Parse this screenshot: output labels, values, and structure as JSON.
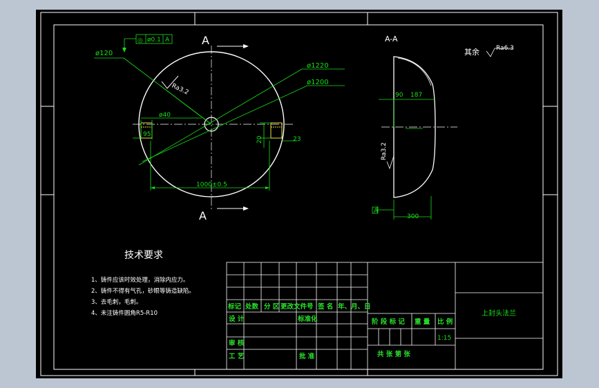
{
  "colors": {
    "background": "#000000",
    "window_frame": "#bcc6d2",
    "outline": "#ffffff",
    "dimension": "#19e019",
    "hatch_hole": "#f0e040",
    "title_text": "#29e029"
  },
  "drawing": {
    "front_view": {
      "section_marker_top": "A",
      "section_marker_bottom": "A",
      "dims": {
        "d120": "ø120",
        "d1220": "ø1220",
        "d1200": "ø1200",
        "d40": "ø40",
        "d95": "95",
        "d20": "20",
        "d23": "23",
        "d1000": "1000±0.5"
      },
      "roughness": "Ra3.2",
      "tolerance_frame": {
        "symbol": "◎",
        "value": "ø0.1",
        "datum": "A"
      }
    },
    "section_view": {
      "title": "A-A",
      "dims": {
        "d90": "90",
        "d187": "187",
        "d300": "300"
      },
      "roughness": "Ra3.2",
      "datum": "A"
    },
    "surface_note": {
      "label": "其余",
      "roughness": "Ra6.3"
    },
    "tech_requirements": {
      "title": "技术要求",
      "items": [
        "1、铸件应该时效处理，消除内应力。",
        "2、铸件不得有气孔，砂眼等铸造缺陷。",
        "3、去毛刺，毛刺。",
        "4、未注铸件圆角R5-R10"
      ]
    }
  },
  "title_block": {
    "headers": [
      "标记",
      "处数",
      "分 区",
      "更改文件号",
      "签 名",
      "年、月、日"
    ],
    "design": "设 计",
    "standardize": "标准化",
    "review": "审 核",
    "process": "工 艺",
    "approve": "批 准",
    "stage_mark": "阶 段 标 记",
    "weight": "重 量",
    "scale": "比 例",
    "scale_value": "1:15",
    "sheets": "共   张  第   张",
    "part_name": "上封头法兰"
  }
}
